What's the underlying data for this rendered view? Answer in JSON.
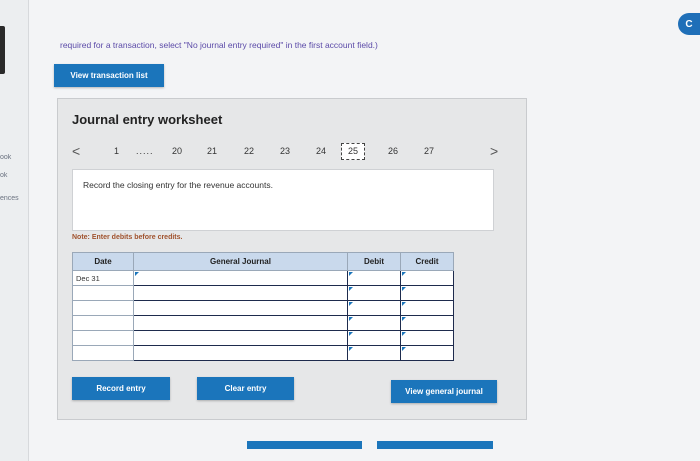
{
  "side_labels": [
    "ook",
    "ok",
    "ences"
  ],
  "corner_letter": "C",
  "instruction": "required for a transaction, select \"No journal entry required\" in the first account field.)",
  "view_transaction_list": "View transaction list",
  "worksheet": {
    "title": "Journal entry worksheet",
    "pager": {
      "prev": "<",
      "first": "1",
      "dots": ".....",
      "pages": [
        "20",
        "21",
        "22",
        "23",
        "24"
      ],
      "current": "25",
      "after": [
        "26",
        "27"
      ],
      "next": ">"
    },
    "description": "Record the closing entry for the revenue accounts.",
    "note": "Note: Enter debits before credits.",
    "table": {
      "headers": [
        "Date",
        "General Journal",
        "Debit",
        "Credit"
      ],
      "rows": [
        {
          "date": "Dec 31",
          "account": "",
          "debit": "",
          "credit": ""
        },
        {
          "date": "",
          "account": "",
          "debit": "",
          "credit": ""
        },
        {
          "date": "",
          "account": "",
          "debit": "",
          "credit": ""
        },
        {
          "date": "",
          "account": "",
          "debit": "",
          "credit": ""
        },
        {
          "date": "",
          "account": "",
          "debit": "",
          "credit": ""
        },
        {
          "date": "",
          "account": "",
          "debit": "",
          "credit": ""
        }
      ]
    }
  },
  "buttons": {
    "record": "Record entry",
    "clear": "Clear entry",
    "view_journal": "View general journal"
  },
  "colors": {
    "primary_button": "#1b75bb",
    "table_header": "#c9d9ec",
    "instruction_text": "#5b4aa8",
    "note_text": "#a0522d"
  }
}
